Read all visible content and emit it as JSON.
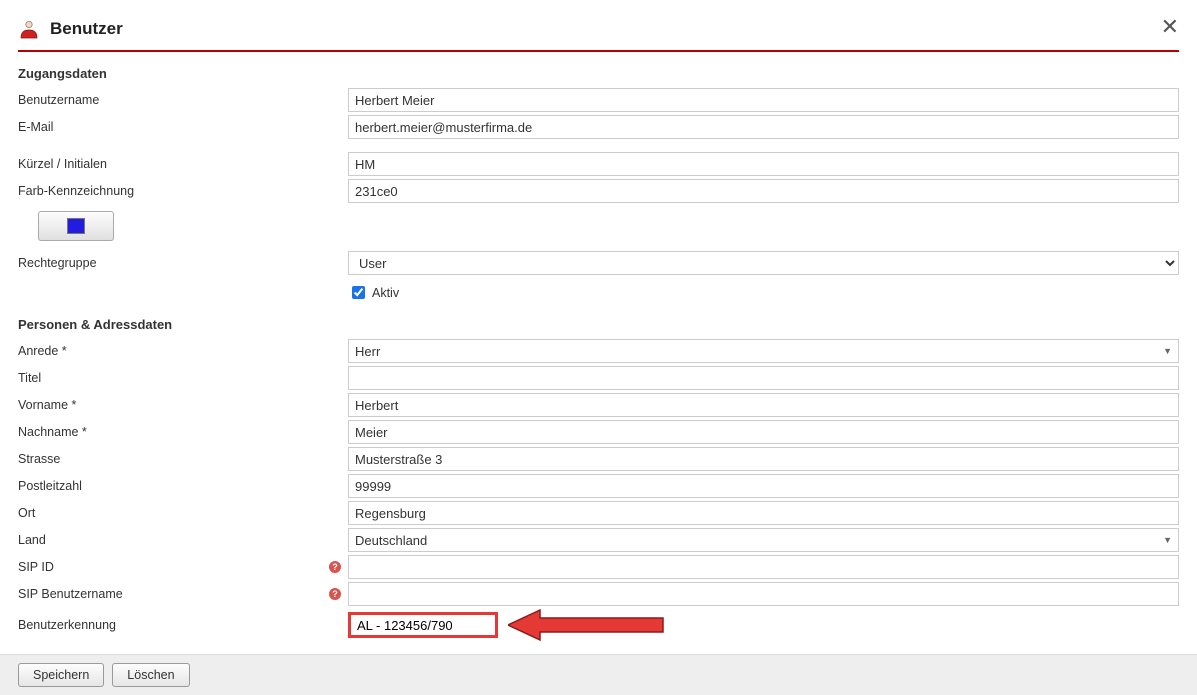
{
  "header": {
    "title": "Benutzer"
  },
  "section1": {
    "title": "Zugangsdaten"
  },
  "section2": {
    "title": "Personen & Adressdaten"
  },
  "labels": {
    "username": "Benutzername",
    "email": "E-Mail",
    "initials": "Kürzel / Initialen",
    "colorMark": "Farb-Kennzeichnung",
    "roleGroup": "Rechtegruppe",
    "active": "Aktiv",
    "salutation": "Anrede *",
    "titleField": "Titel",
    "firstname": "Vorname *",
    "lastname": "Nachname *",
    "street": "Strasse",
    "zip": "Postleitzahl",
    "city": "Ort",
    "country": "Land",
    "sipId": "SIP ID",
    "sipUser": "SIP Benutzername",
    "userKey": "Benutzerkennung"
  },
  "values": {
    "username": "Herbert Meier",
    "email": "herbert.meier@musterfirma.de",
    "initials": "HM",
    "colorMark": "231ce0",
    "roleGroup": "User",
    "activeChecked": true,
    "salutation": "Herr",
    "titleField": "",
    "firstname": "Herbert",
    "lastname": "Meier",
    "street": "Musterstraße 3",
    "zip": "99999",
    "city": "Regensburg",
    "country": "Deutschland",
    "sipId": "",
    "sipUser": "",
    "userKey": "AL - 123456/790"
  },
  "buttons": {
    "save": "Speichern",
    "delete": "Löschen"
  },
  "colors": {
    "accent": "#b40000",
    "highlight": "#e53935",
    "swatch": "#231ce0"
  }
}
